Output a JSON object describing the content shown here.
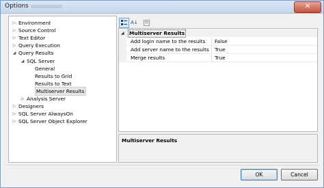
{
  "window": {
    "title": "Options",
    "close_glyph": "✕"
  },
  "tree": [
    {
      "label": "Environment",
      "expander": "right",
      "indent": 0
    },
    {
      "label": "Source Control",
      "expander": "right",
      "indent": 0
    },
    {
      "label": "Text Editor",
      "expander": "right",
      "indent": 0
    },
    {
      "label": "Query Execution",
      "expander": "right",
      "indent": 0
    },
    {
      "label": "Query Results",
      "expander": "down",
      "indent": 0
    },
    {
      "label": "SQL Server",
      "expander": "down",
      "indent": 1
    },
    {
      "label": "General",
      "expander": "none",
      "indent": 2
    },
    {
      "label": "Results to Grid",
      "expander": "none",
      "indent": 2
    },
    {
      "label": "Results to Text",
      "expander": "none",
      "indent": 2
    },
    {
      "label": "Multiserver Results",
      "expander": "none",
      "indent": 2,
      "selected": true
    },
    {
      "label": "Analysis Server",
      "expander": "right",
      "indent": 1
    },
    {
      "label": "Designers",
      "expander": "right",
      "indent": 0
    },
    {
      "label": "SQL Server AlwaysOn",
      "expander": "right",
      "indent": 0
    },
    {
      "label": "SQL Server Object Explorer",
      "expander": "right",
      "indent": 0
    }
  ],
  "toolbar": {
    "categorized_icon": "categorized-icon",
    "alphabetical_glyph": "A↓",
    "property_pages_icon": "property-pages-icon"
  },
  "grid": {
    "category": "Multiserver Results",
    "properties": [
      {
        "name": "Add login name to the results",
        "value": "False"
      },
      {
        "name": "Add server name to the results",
        "value": "True"
      },
      {
        "name": "Merge results",
        "value": "True"
      }
    ]
  },
  "description": {
    "title": "Multiserver Results"
  },
  "buttons": {
    "ok": "OK",
    "cancel": "Cancel"
  }
}
